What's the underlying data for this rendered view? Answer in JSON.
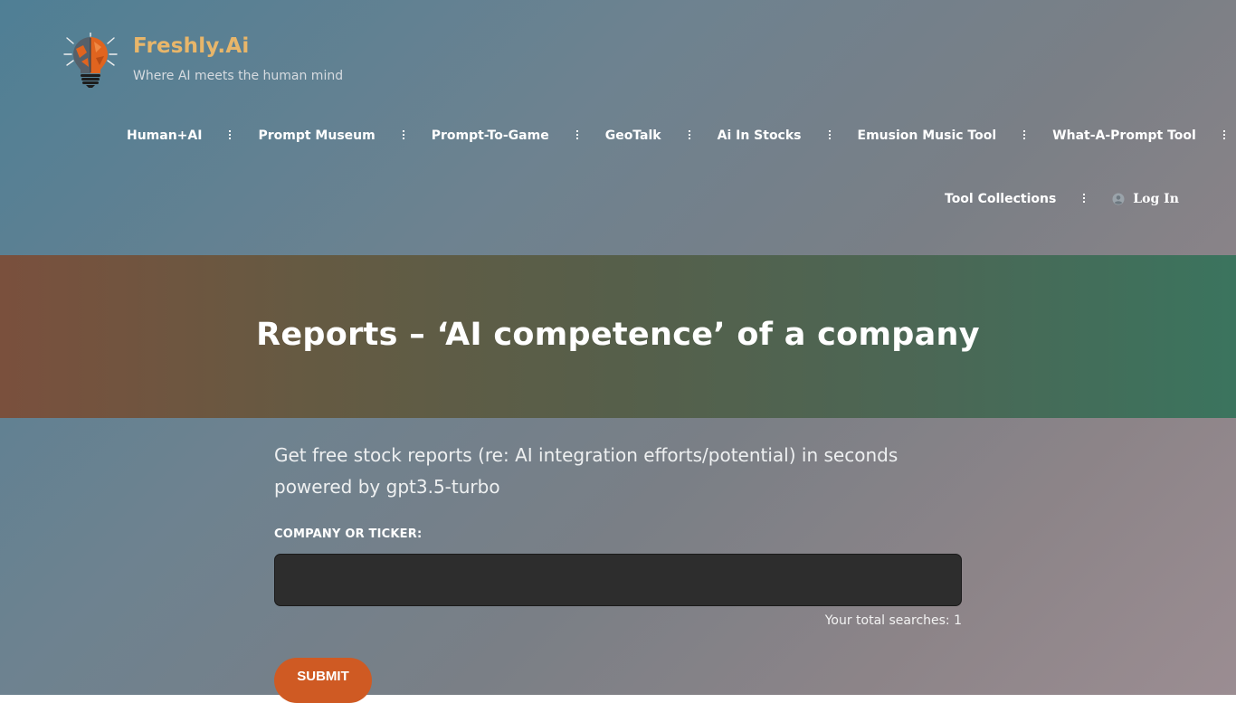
{
  "site": {
    "title": "Freshly.Ai",
    "tagline": "Where AI meets the human mind",
    "title_color": "#e8b66a"
  },
  "nav": {
    "primary": [
      "Human+AI",
      "Prompt Museum",
      "Prompt-To-Game",
      "GeoTalk",
      "Ai In Stocks",
      "Emusion Music Tool",
      "What-A-Prompt Tool"
    ],
    "secondary": [
      "Tool Collections"
    ],
    "login_label": "Log In",
    "login_icon": "user-circle-icon"
  },
  "hero": {
    "title": "Reports – ‘AI competence’ of a company",
    "gradient": [
      "#7a503d",
      "#3b745e"
    ]
  },
  "form": {
    "intro": "Get free stock reports (re: AI integration efforts/potential) in seconds powered by gpt3.5-turbo",
    "field_label": "COMPANY OR TICKER:",
    "input_value": "",
    "input_placeholder": "",
    "search_count": "Your total searches: 1",
    "submit_label": "SUBMIT",
    "submit_color": "#cf5a23"
  }
}
